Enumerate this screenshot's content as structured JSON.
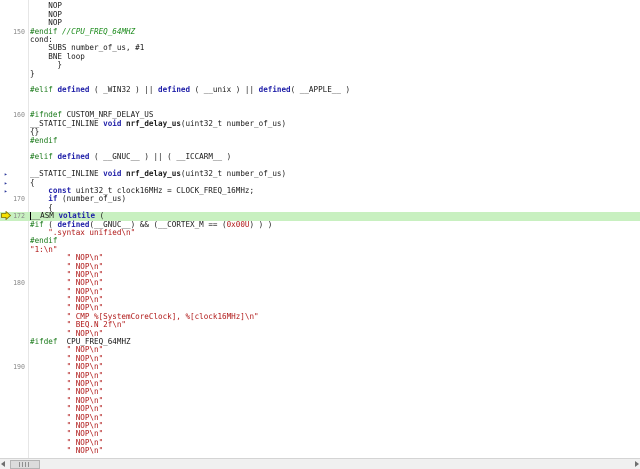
{
  "editor": {
    "lines": [
      {
        "num": "",
        "text": "    NOP",
        "kind": "plain"
      },
      {
        "num": "",
        "text": "    NOP",
        "kind": "plain"
      },
      {
        "num": "",
        "text": "    NOP",
        "kind": "plain"
      },
      {
        "num": "",
        "text": "    NOP",
        "kind": "plain"
      },
      {
        "num": "150",
        "text": "#endif //CPU_FREQ_64MHZ",
        "kind": "endif"
      },
      {
        "num": "",
        "text": "cond:",
        "kind": "plain"
      },
      {
        "num": "",
        "text": "    SUBS number_of_us, #1",
        "kind": "plain"
      },
      {
        "num": "",
        "text": "    BNE loop",
        "kind": "plain"
      },
      {
        "num": "",
        "text": "      }",
        "kind": "plain"
      },
      {
        "num": "",
        "text": "}",
        "kind": "plain"
      },
      {
        "num": "",
        "text": "",
        "kind": "plain"
      },
      {
        "num": "",
        "text": "#elif defined ( _WIN32 ) || defined ( __unix ) || defined( __APPLE__ )",
        "kind": "elif"
      },
      {
        "num": "",
        "text": "",
        "kind": "plain"
      },
      {
        "num": "",
        "text": "",
        "kind": "plain"
      },
      {
        "num": "160",
        "text": "#ifndef CUSTOM_NRF_DELAY_US",
        "kind": "pp"
      },
      {
        "num": "",
        "text": "__STATIC_INLINE void nrf_delay_us(uint32_t number_of_us)",
        "kind": "func"
      },
      {
        "num": "",
        "text": "{}",
        "kind": "plain"
      },
      {
        "num": "",
        "text": "#endif",
        "kind": "pp"
      },
      {
        "num": "",
        "text": "",
        "kind": "plain"
      },
      {
        "num": "",
        "text": "#elif defined ( __GNUC__ ) || ( __ICCARM__ )",
        "kind": "elif"
      },
      {
        "num": "",
        "text": "",
        "kind": "plain"
      },
      {
        "num": "",
        "text": "__STATIC_INLINE void nrf_delay_us(uint32_t number_of_us)",
        "kind": "func",
        "marker": true
      },
      {
        "num": "",
        "text": "{",
        "kind": "plain",
        "marker": true
      },
      {
        "num": "",
        "text": "    const uint32_t clock16MHz = CLOCK_FREQ_16MHz;",
        "kind": "const",
        "marker": true
      },
      {
        "num": "170",
        "text": "    if (number_of_us)",
        "kind": "if"
      },
      {
        "num": "",
        "text": "    {",
        "kind": "plain"
      },
      {
        "num": "172",
        "text": "__ASM volatile (",
        "kind": "asm",
        "current": true
      },
      {
        "num": "",
        "text": "#if ( defined(__GNUC__) && (__CORTEX_M == (0x00U) ) )",
        "kind": "ifgnu"
      },
      {
        "num": "",
        "text": "    \".syntax unified\\n\"",
        "kind": "str"
      },
      {
        "num": "",
        "text": "#endif",
        "kind": "pp"
      },
      {
        "num": "",
        "text": "\"1:\\n\"",
        "kind": "str"
      },
      {
        "num": "",
        "text": "        \" NOP\\n\"",
        "kind": "str"
      },
      {
        "num": "",
        "text": "        \" NOP\\n\"",
        "kind": "str"
      },
      {
        "num": "",
        "text": "        \" NOP\\n\"",
        "kind": "str"
      },
      {
        "num": "180",
        "text": "        \" NOP\\n\"",
        "kind": "str"
      },
      {
        "num": "",
        "text": "        \" NOP\\n\"",
        "kind": "str"
      },
      {
        "num": "",
        "text": "        \" NOP\\n\"",
        "kind": "str"
      },
      {
        "num": "",
        "text": "        \" NOP\\n\"",
        "kind": "str"
      },
      {
        "num": "",
        "text": "        \" CMP %[SystemCoreClock], %[clock16MHz]\\n\"",
        "kind": "str"
      },
      {
        "num": "",
        "text": "        \" BEQ.N 2f\\n\"",
        "kind": "str"
      },
      {
        "num": "",
        "text": "        \" NOP\\n\"",
        "kind": "str"
      },
      {
        "num": "",
        "text": "#ifdef  CPU_FREQ_64MHZ",
        "kind": "pp"
      },
      {
        "num": "",
        "text": "        \" NOP\\n\"",
        "kind": "str"
      },
      {
        "num": "",
        "text": "        \" NOP\\n\"",
        "kind": "str"
      },
      {
        "num": "190",
        "text": "        \" NOP\\n\"",
        "kind": "str"
      },
      {
        "num": "",
        "text": "        \" NOP\\n\"",
        "kind": "str"
      },
      {
        "num": "",
        "text": "        \" NOP\\n\"",
        "kind": "str"
      },
      {
        "num": "",
        "text": "        \" NOP\\n\"",
        "kind": "str"
      },
      {
        "num": "",
        "text": "        \" NOP\\n\"",
        "kind": "str"
      },
      {
        "num": "",
        "text": "        \" NOP\\n\"",
        "kind": "str"
      },
      {
        "num": "",
        "text": "        \" NOP\\n\"",
        "kind": "str"
      },
      {
        "num": "",
        "text": "        \" NOP\\n\"",
        "kind": "str"
      },
      {
        "num": "",
        "text": "        \" NOP\\n\"",
        "kind": "str"
      },
      {
        "num": "",
        "text": "        \" NOP\\n\"",
        "kind": "str"
      },
      {
        "num": "",
        "text": "        \" NOP\\n\"",
        "kind": "str"
      }
    ],
    "current_line": "172"
  },
  "icons": {
    "execution_pointer": "yellow-arrow-icon",
    "bookmark_marker": "triangle-marker-icon",
    "scroll_left": "chevron-left-icon",
    "scroll_right": "chevron-right-icon",
    "scroll_thumb": "scrollbar-grip-icon"
  },
  "colors": {
    "current_line_bg": "#c8f0c0",
    "keyword": "#1f1fa8",
    "string": "#b01818",
    "preprocessor": "#1a7a1a"
  }
}
